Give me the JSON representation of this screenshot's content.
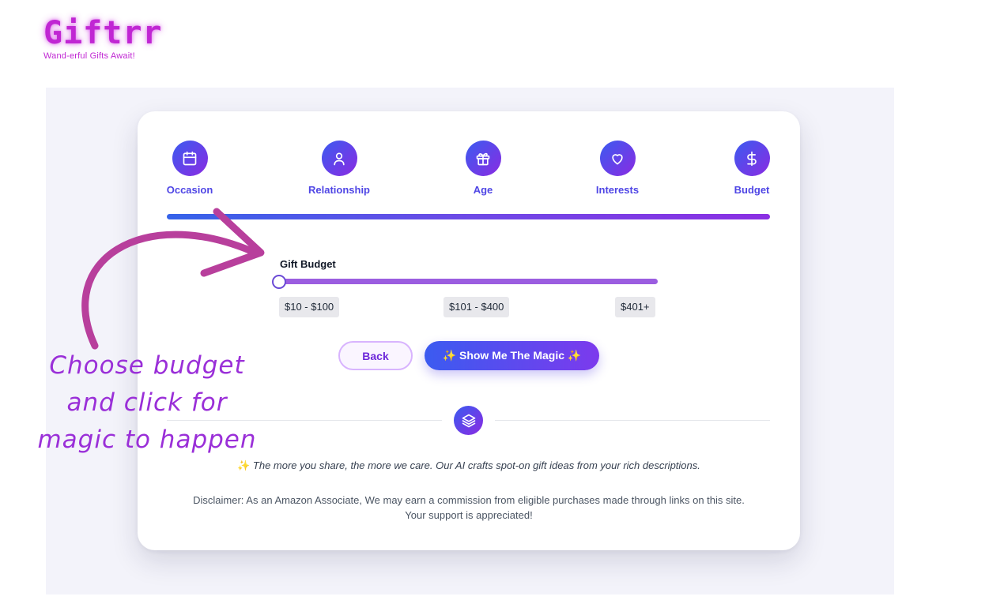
{
  "logo": {
    "title": "Giftrr",
    "tagline": "Wand-erful Gifts Await!"
  },
  "steps": [
    {
      "label": "Occasion",
      "icon": "calendar-icon"
    },
    {
      "label": "Relationship",
      "icon": "user-icon"
    },
    {
      "label": "Age",
      "icon": "gift-icon"
    },
    {
      "label": "Interests",
      "icon": "heart-icon"
    },
    {
      "label": "Budget",
      "icon": "dollar-icon"
    }
  ],
  "progress": 1.0,
  "budget": {
    "label": "Gift Budget",
    "options": [
      "$10 - $100",
      "$101 - $400",
      "$401+"
    ],
    "selected_index": 0
  },
  "buttons": {
    "back": "Back",
    "magic": "✨ Show Me The Magic ✨"
  },
  "divider_icon": "layers-icon",
  "tagline": {
    "sparkle": "✨",
    "text": "The more you share, the more we care. Our AI crafts spot-on gift ideas from your rich descriptions."
  },
  "disclaimer": {
    "line1": "Disclaimer: As an Amazon Associate, We may earn a commission from eligible purchases made through links on this site.",
    "line2": "Your support is appreciated!"
  },
  "annotation": {
    "line1": "Choose budget",
    "line2": "and click for",
    "line3": "magic to happen"
  },
  "colors": {
    "brand_gradient_start": "#3b5bf0",
    "brand_gradient_end": "#8a2be2",
    "logo": "#c026d3",
    "annotation": "#9a2fd8",
    "arrow": "#b83f9c",
    "slider": "#9b5de0"
  }
}
